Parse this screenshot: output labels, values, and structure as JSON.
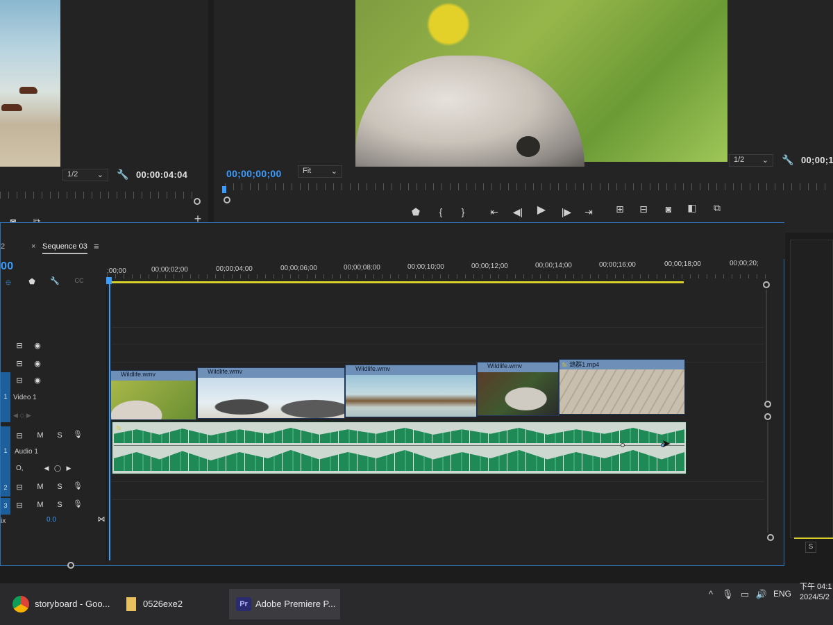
{
  "source_monitor": {
    "zoom_select": "1/2",
    "timecode": "00:00:04:04"
  },
  "program_monitor": {
    "timecode": "00;00;00;00",
    "fit_select": "Fit",
    "zoom_select": "1/2",
    "timecode_right": "00;00;1"
  },
  "timeline": {
    "tab_num": "2",
    "sequence_name": "Sequence 03",
    "playhead_tc": "00",
    "ruler_labels": [
      ";00;00",
      "00;00;02;00",
      "00;00;04;00",
      "00;00;06;00",
      "00;00;08;00",
      "00;00;10;00",
      "00;00;12;00",
      "00;00;14;00",
      "00;00;16;00",
      "00;00;18;00",
      "00;00;20;"
    ],
    "tracks": {
      "video1_label": "Video 1",
      "audio1_label": "Audio 1",
      "v_num": "1",
      "a_num": "1",
      "a2_num": "2",
      "a3_num": "3",
      "mix_label": "ix",
      "mix_value": "0.0",
      "audio_value_label": "O,"
    },
    "clips": [
      "Wildlife.wmv",
      "Wildlife.wmv",
      "Wildlife.wmv",
      "Wildlife.wmv",
      "鴿群1.mp4"
    ],
    "fx_badge": "fx"
  },
  "right_panel": {
    "s_label": "S"
  },
  "taskbar": {
    "chrome_label": "storyboard - Goo...",
    "folder_label": "0526exe2",
    "premiere_label": "Adobe Premiere P...",
    "premiere_badge": "Pr",
    "lang": "ENG",
    "time": "下午 04:1",
    "date": "2024/5/2"
  }
}
